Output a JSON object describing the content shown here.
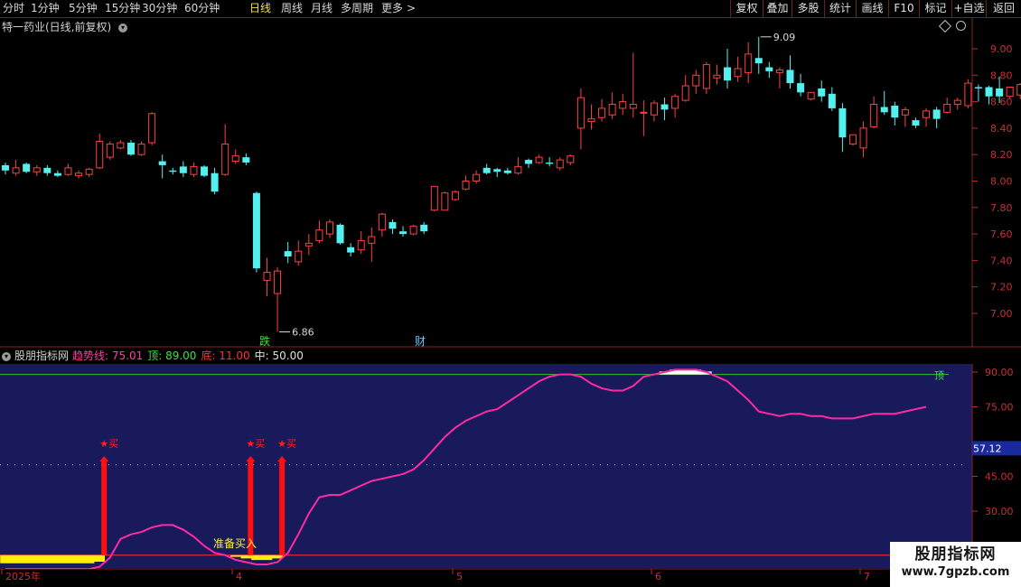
{
  "toolbar": {
    "periods": [
      "分时",
      "1分钟",
      "5分钟",
      "15分钟",
      "30分钟",
      "60分钟",
      "日线",
      "周线",
      "月线",
      "多周期",
      "更多"
    ],
    "active_period": "日线",
    "more_arrow": ">",
    "right_buttons": [
      "复权",
      "叠加",
      "多股",
      "统计",
      "画线",
      "F10",
      "标记",
      "+自选",
      "返回"
    ]
  },
  "main_panel": {
    "title": "特一药业(日线,前复权)",
    "menu_icon": "circle-chevron-down-icon",
    "corner_icons": [
      "diamond-icon",
      "circle-icon"
    ],
    "high_label": "9.09",
    "low_label": "6.86",
    "markers": [
      "跌",
      "财"
    ]
  },
  "indicator_panel": {
    "name": "股朋指标网",
    "params": [
      {
        "label": "趋势线:",
        "value": "75.01",
        "color": "#ff3fa0"
      },
      {
        "label": "顶:",
        "value": "89.00",
        "color": "#40e040"
      },
      {
        "label": "底:",
        "value": "11.00",
        "color": "#ff3030"
      },
      {
        "label": "中:",
        "value": "50.00",
        "color": "#e0e0e0"
      }
    ],
    "buy_label": "★买",
    "prepare_label": "准备买入",
    "top_label": "顶",
    "current_value": "57.12"
  },
  "date_axis": [
    "2025年",
    "4",
    "5",
    "6",
    "7"
  ],
  "watermark": {
    "line1": "股朋指标网",
    "line2": "www.7gpzb.com"
  },
  "colors": {
    "up": "#ff4040",
    "down": "#54f0f0",
    "trend": "#ff2aa0",
    "top": "#30c030",
    "panel_bg": "#181a5c",
    "axis": "#b03030"
  },
  "chart_data": [
    {
      "type": "candlestick",
      "title": "特一药业(日线,前复权)",
      "y_ticks": [
        7.0,
        7.2,
        7.4,
        7.6,
        7.8,
        8.0,
        8.2,
        8.4,
        8.6,
        8.8,
        9.0
      ],
      "ylim": [
        6.86,
        9.09
      ],
      "candles": [
        [
          8.12,
          8.14,
          8.08,
          8.05
        ],
        [
          8.06,
          8.16,
          8.1,
          8.04
        ],
        [
          8.13,
          8.14,
          8.07,
          8.06
        ],
        [
          8.07,
          8.12,
          8.1,
          8.04
        ],
        [
          8.1,
          8.12,
          8.06,
          8.04
        ],
        [
          8.06,
          8.08,
          8.04,
          8.03
        ],
        [
          8.05,
          8.13,
          8.1,
          8.04
        ],
        [
          8.04,
          8.08,
          8.06,
          8.02
        ],
        [
          8.05,
          8.1,
          8.09,
          8.03
        ],
        [
          8.1,
          8.36,
          8.3,
          8.09
        ],
        [
          8.18,
          8.3,
          8.28,
          8.16
        ],
        [
          8.25,
          8.31,
          8.29,
          8.24
        ],
        [
          8.29,
          8.31,
          8.2,
          8.19
        ],
        [
          8.2,
          8.3,
          8.28,
          8.19
        ],
        [
          8.29,
          8.52,
          8.51,
          8.27
        ],
        [
          8.15,
          8.2,
          8.12,
          8.02
        ],
        [
          8.08,
          8.1,
          8.07,
          8.05
        ],
        [
          8.11,
          8.15,
          8.06,
          8.03
        ],
        [
          8.05,
          8.14,
          8.11,
          8.03
        ],
        [
          8.11,
          8.12,
          8.04,
          8.03
        ],
        [
          8.06,
          8.1,
          7.92,
          7.9
        ],
        [
          8.05,
          8.43,
          8.28,
          8.04
        ],
        [
          8.15,
          8.24,
          8.19,
          8.13
        ],
        [
          8.18,
          8.21,
          8.14,
          8.12
        ],
        [
          7.91,
          7.92,
          7.34,
          7.31
        ],
        [
          7.25,
          7.42,
          7.31,
          7.13
        ],
        [
          7.15,
          7.35,
          7.32,
          6.86
        ],
        [
          7.47,
          7.54,
          7.43,
          7.38
        ],
        [
          7.39,
          7.55,
          7.47,
          7.36
        ],
        [
          7.51,
          7.6,
          7.53,
          7.44
        ],
        [
          7.55,
          7.7,
          7.63,
          7.53
        ],
        [
          7.6,
          7.71,
          7.69,
          7.57
        ],
        [
          7.67,
          7.68,
          7.53,
          7.52
        ],
        [
          7.5,
          7.53,
          7.46,
          7.43
        ],
        [
          7.48,
          7.62,
          7.55,
          7.45
        ],
        [
          7.53,
          7.65,
          7.58,
          7.39
        ],
        [
          7.63,
          7.76,
          7.75,
          7.58
        ],
        [
          7.69,
          7.71,
          7.64,
          7.6
        ],
        [
          7.62,
          7.66,
          7.6,
          7.58
        ],
        [
          7.6,
          7.67,
          7.66,
          7.59
        ],
        [
          7.67,
          7.69,
          7.62,
          7.6
        ],
        [
          7.78,
          7.95,
          7.96,
          7.77
        ],
        [
          7.78,
          7.92,
          7.91,
          7.78
        ],
        [
          7.86,
          7.93,
          7.92,
          7.85
        ],
        [
          7.94,
          8.04,
          8.0,
          7.93
        ],
        [
          8.0,
          8.08,
          8.05,
          7.98
        ],
        [
          8.1,
          8.13,
          8.06,
          8.05
        ],
        [
          8.09,
          8.1,
          8.07,
          8.03
        ],
        [
          8.08,
          8.1,
          8.06,
          8.05
        ],
        [
          8.06,
          8.18,
          8.11,
          8.05
        ],
        [
          8.16,
          8.17,
          8.13,
          8.1
        ],
        [
          8.14,
          8.2,
          8.18,
          8.13
        ],
        [
          8.14,
          8.18,
          8.13,
          8.11
        ],
        [
          8.1,
          8.18,
          8.16,
          8.08
        ],
        [
          8.14,
          8.2,
          8.19,
          8.12
        ],
        [
          8.4,
          8.7,
          8.63,
          8.24
        ],
        [
          8.45,
          8.58,
          8.47,
          8.39
        ],
        [
          8.48,
          8.62,
          8.55,
          8.45
        ],
        [
          8.5,
          8.67,
          8.58,
          8.47
        ],
        [
          8.55,
          8.66,
          8.6,
          8.5
        ],
        [
          8.55,
          8.97,
          8.58,
          8.48
        ],
        [
          8.52,
          8.61,
          8.52,
          8.34
        ],
        [
          8.5,
          8.61,
          8.59,
          8.45
        ],
        [
          8.58,
          8.63,
          8.54,
          8.46
        ],
        [
          8.55,
          8.66,
          8.64,
          8.48
        ],
        [
          8.61,
          8.8,
          8.72,
          8.6
        ],
        [
          8.72,
          8.84,
          8.8,
          8.66
        ],
        [
          8.7,
          8.9,
          8.88,
          8.66
        ],
        [
          8.78,
          8.88,
          8.8,
          8.73
        ],
        [
          8.86,
          9.0,
          8.76,
          8.7
        ],
        [
          8.79,
          8.94,
          8.85,
          8.75
        ],
        [
          8.82,
          9.05,
          8.96,
          8.74
        ],
        [
          8.93,
          9.09,
          8.89,
          8.81
        ],
        [
          8.86,
          8.9,
          8.83,
          8.78
        ],
        [
          8.82,
          8.86,
          8.84,
          8.7
        ],
        [
          8.84,
          8.95,
          8.74,
          8.7
        ],
        [
          8.74,
          8.81,
          8.67,
          8.64
        ],
        [
          8.62,
          8.66,
          8.67,
          8.61
        ],
        [
          8.7,
          8.76,
          8.64,
          8.6
        ],
        [
          8.66,
          8.71,
          8.55,
          8.53
        ],
        [
          8.55,
          8.59,
          8.33,
          8.22
        ],
        [
          8.28,
          8.34,
          8.35,
          8.27
        ],
        [
          8.25,
          8.45,
          8.4,
          8.18
        ],
        [
          8.41,
          8.64,
          8.58,
          8.4
        ],
        [
          8.56,
          8.68,
          8.52,
          8.5
        ],
        [
          8.57,
          8.6,
          8.48,
          8.42
        ],
        [
          8.5,
          8.56,
          8.54,
          8.41
        ],
        [
          8.46,
          8.48,
          8.42,
          8.4
        ],
        [
          8.48,
          8.55,
          8.53,
          8.41
        ],
        [
          8.54,
          8.56,
          8.47,
          8.4
        ],
        [
          8.52,
          8.63,
          8.58,
          8.51
        ],
        [
          8.58,
          8.63,
          8.61,
          8.54
        ],
        [
          8.57,
          8.77,
          8.74,
          8.55
        ],
        [
          8.71,
          8.73,
          8.7,
          8.6
        ],
        [
          8.71,
          8.72,
          8.64,
          8.58
        ],
        [
          8.7,
          8.79,
          8.64,
          8.59
        ],
        [
          8.64,
          8.71,
          8.71,
          8.62
        ],
        [
          8.65,
          8.74,
          8.73,
          8.62
        ]
      ]
    },
    {
      "type": "line",
      "title": "股朋指标网",
      "y_ticks": [
        30.0,
        45.0,
        75.0,
        90.0
      ],
      "ylim": [
        0,
        100
      ],
      "reference_lines": {
        "top": 89.0,
        "middle": 50.0,
        "bottom": 11.0
      },
      "trend": [
        5,
        5,
        5,
        5,
        5,
        5,
        5,
        5,
        5,
        6,
        10,
        18,
        20,
        21,
        23,
        24,
        24,
        22,
        19,
        15,
        12,
        11,
        9,
        8,
        7,
        7,
        8,
        12,
        20,
        29,
        36,
        37,
        37,
        39,
        41,
        43,
        44,
        45,
        46,
        48,
        52,
        57,
        62,
        66,
        69,
        71,
        73,
        74,
        77,
        80,
        83,
        86,
        88,
        89,
        89,
        88,
        85,
        83,
        82,
        82,
        84,
        88,
        89,
        90,
        91,
        91,
        91,
        90,
        88,
        86,
        82,
        78,
        73,
        72,
        71,
        72,
        72,
        71,
        71,
        70,
        70,
        70,
        71,
        72,
        72,
        72,
        73,
        74,
        75
      ],
      "buy_signals": [
        9,
        23,
        26
      ],
      "prepare_buy_index": 22
    }
  ]
}
